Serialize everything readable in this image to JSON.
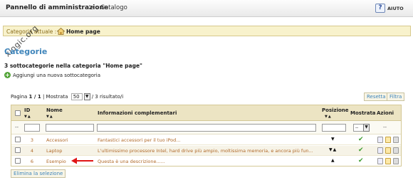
{
  "header": {
    "title": "Pannello di amministrazione",
    "separator": ">",
    "current": "Catalogo",
    "help_label": "AIUTO",
    "help_icon": "help-question-icon"
  },
  "watermark": "xlogic.org",
  "category_bar": {
    "label": "Categoria attuale :",
    "value": "Home page",
    "icon": "home-icon"
  },
  "section": {
    "title": "Categorie",
    "subtitle": "3 sottocategorie nella categoria \"Home page\"",
    "add_label": "Aggiungi una nuova sottocategoria"
  },
  "pager": {
    "page_prefix": "Pagina",
    "page_value": "1 / 1",
    "show_label": "| Mostrata",
    "per_page": "50",
    "results": "/ 3 risultato/i",
    "reset_label": "Resetta",
    "filter_label": "Filtra"
  },
  "table": {
    "columns": {
      "id": "ID",
      "name": "Nome",
      "info": "Informazioni complementari",
      "position": "Posizione",
      "shown": "Mostrata",
      "actions": "Azioni"
    },
    "filter_dash": "--",
    "filter_select": "--",
    "rows": [
      {
        "id": "3",
        "name": "Accessori",
        "info": "Fantastici accessori per il tuo iPod...",
        "position": "down"
      },
      {
        "id": "4",
        "name": "Laptop",
        "info": "L'ultimissimo processore Intel, hard drive più ampio, moltissima memoria, e ancora più fun...",
        "position": "updown"
      },
      {
        "id": "6",
        "name": "Esempio",
        "info": "Questa è una descrizione......",
        "position": "up"
      }
    ]
  },
  "footer": {
    "delete_label": "Elimina la selezione"
  },
  "colors": {
    "accent": "#3f85bb",
    "category_bar": "#f8f2cc",
    "header_row": "#ece4c3",
    "link": "#b06a2a",
    "check": "#3b9b2c",
    "arrow": "#e01515"
  }
}
